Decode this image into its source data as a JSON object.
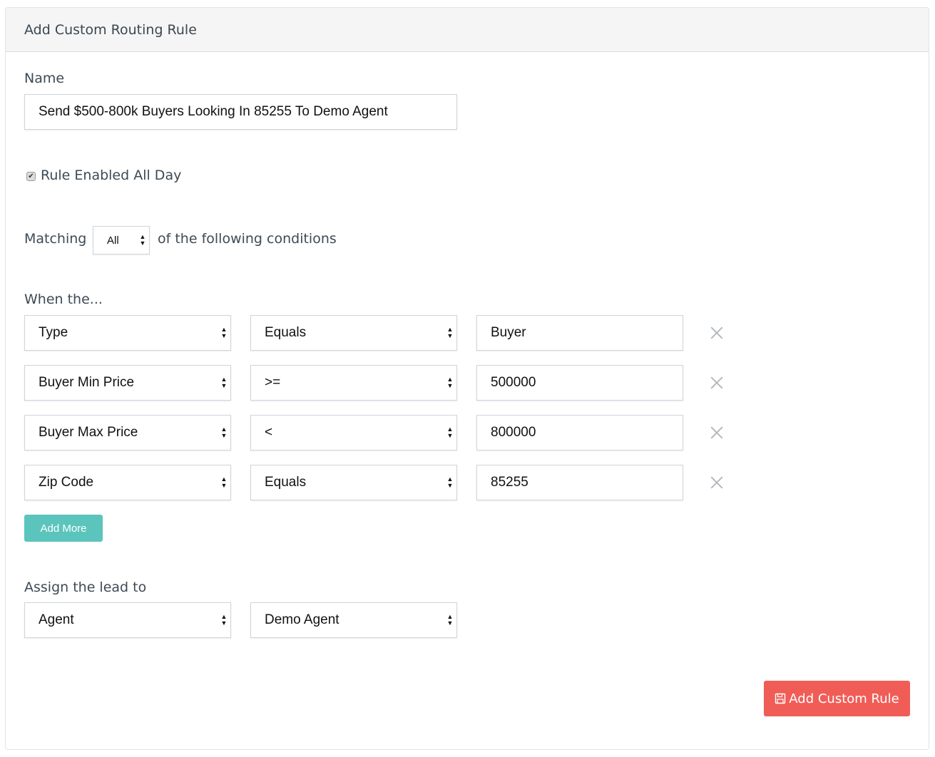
{
  "header": {
    "title": "Add Custom Routing Rule"
  },
  "name_field": {
    "label": "Name",
    "value": "Send $500-800k Buyers Looking In 85255 To Demo Agent"
  },
  "enabled": {
    "label": "Rule Enabled All Day",
    "checked": true,
    "check_glyph": "✔"
  },
  "matching": {
    "prefix": "Matching",
    "selected": "All",
    "suffix": "of the following conditions"
  },
  "conditions": {
    "label": "When the...",
    "rows": [
      {
        "field": "Type",
        "operator": "Equals",
        "value": "Buyer"
      },
      {
        "field": "Buyer Min Price",
        "operator": ">=",
        "value": "500000"
      },
      {
        "field": "Buyer Max Price",
        "operator": "<",
        "value": "800000"
      },
      {
        "field": "Zip Code",
        "operator": "Equals",
        "value": "85255"
      }
    ],
    "add_more_label": "Add More"
  },
  "assign": {
    "label": "Assign the lead to",
    "type": "Agent",
    "target": "Demo Agent"
  },
  "submit": {
    "label": "Add Custom Rule",
    "icon": "floppy-disk-icon"
  },
  "colors": {
    "add_more_bg": "#5bc4bd",
    "submit_bg": "#f05d57",
    "header_bg": "#f5f5f5"
  }
}
